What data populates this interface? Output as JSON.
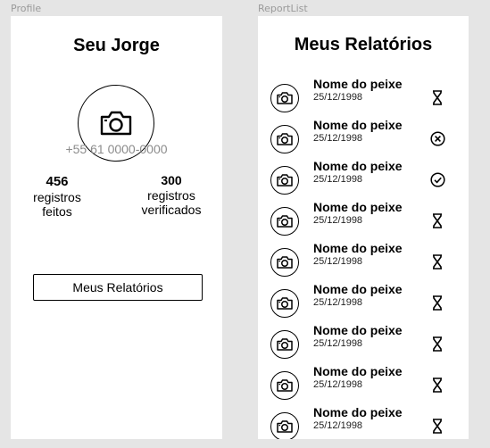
{
  "frames": {
    "profile_label": "Profile",
    "reports_label": "ReportList"
  },
  "profile": {
    "name": "Seu Jorge",
    "avatar_icon": "camera-icon",
    "phone": "+55 61 0000-0000",
    "stats": [
      {
        "value": "456",
        "label_line1": "registros",
        "label_line2": "feitos"
      },
      {
        "value": "300",
        "label_line1": "registros",
        "label_line2": "verificados"
      }
    ],
    "button_label": "Meus Relatórios"
  },
  "reports": {
    "title": "Meus Relatórios",
    "items": [
      {
        "name": "Nome do peixe",
        "date": "25/12/1998",
        "status": "pending"
      },
      {
        "name": "Nome do peixe",
        "date": "25/12/1998",
        "status": "rejected"
      },
      {
        "name": "Nome do peixe",
        "date": "25/12/1998",
        "status": "verified"
      },
      {
        "name": "Nome do peixe",
        "date": "25/12/1998",
        "status": "pending"
      },
      {
        "name": "Nome do peixe",
        "date": "25/12/1998",
        "status": "pending"
      },
      {
        "name": "Nome do peixe",
        "date": "25/12/1998",
        "status": "pending"
      },
      {
        "name": "Nome do peixe",
        "date": "25/12/1998",
        "status": "pending"
      },
      {
        "name": "Nome do peixe",
        "date": "25/12/1998",
        "status": "pending"
      },
      {
        "name": "Nome do peixe",
        "date": "25/12/1998",
        "status": "pending"
      }
    ]
  }
}
